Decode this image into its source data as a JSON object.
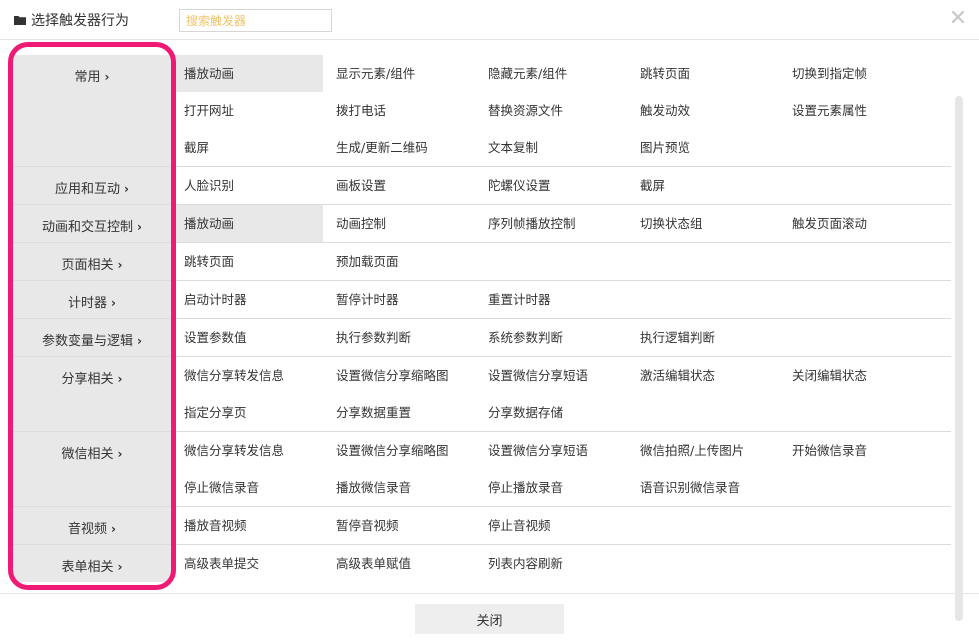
{
  "header": {
    "title": "选择触发器行为",
    "search_placeholder": "搜索触发器",
    "search_value": ""
  },
  "colors": {
    "highlight": "#ee1a74",
    "placeholder": "#f1c36c",
    "category_bg": "#e8e8e8"
  },
  "categories": [
    {
      "label": "常用",
      "items": [
        "播放动画",
        "显示元素/组件",
        "隐藏元素/组件",
        "跳转页面",
        "切换到指定帧",
        "打开网址",
        "拨打电话",
        "替换资源文件",
        "触发动效",
        "设置元素属性",
        "截屏",
        "生成/更新二维码",
        "文本复制",
        "图片预览"
      ],
      "active": 0
    },
    {
      "label": "应用和互动",
      "items": [
        "人脸识别",
        "画板设置",
        "陀螺仪设置",
        "截屏"
      ],
      "active": -1
    },
    {
      "label": "动画和交互控制",
      "items": [
        "播放动画",
        "动画控制",
        "序列帧播放控制",
        "切换状态组",
        "触发页面滚动"
      ],
      "active": 0
    },
    {
      "label": "页面相关",
      "items": [
        "跳转页面",
        "预加载页面"
      ],
      "active": -1
    },
    {
      "label": "计时器",
      "items": [
        "启动计时器",
        "暂停计时器",
        "重置计时器"
      ],
      "active": -1
    },
    {
      "label": "参数变量与逻辑",
      "items": [
        "设置参数值",
        "执行参数判断",
        "系统参数判断",
        "执行逻辑判断"
      ],
      "active": -1
    },
    {
      "label": "分享相关",
      "items": [
        "微信分享转发信息",
        "设置微信分享缩略图",
        "设置微信分享短语",
        "激活编辑状态",
        "关闭编辑状态",
        "指定分享页",
        "分享数据重置",
        "分享数据存储"
      ],
      "active": -1
    },
    {
      "label": "微信相关",
      "items": [
        "微信分享转发信息",
        "设置微信分享缩略图",
        "设置微信分享短语",
        "微信拍照/上传图片",
        "开始微信录音",
        "停止微信录音",
        "播放微信录音",
        "停止播放录音",
        "语音识别微信录音"
      ],
      "active": -1
    },
    {
      "label": "音视频",
      "items": [
        "播放音视频",
        "暂停音视频",
        "停止音视频"
      ],
      "active": -1
    },
    {
      "label": "表单相关",
      "items": [
        "高级表单提交",
        "高级表单赋值",
        "列表内容刷新"
      ],
      "active": -1
    }
  ],
  "footer": {
    "close_label": "关闭"
  }
}
